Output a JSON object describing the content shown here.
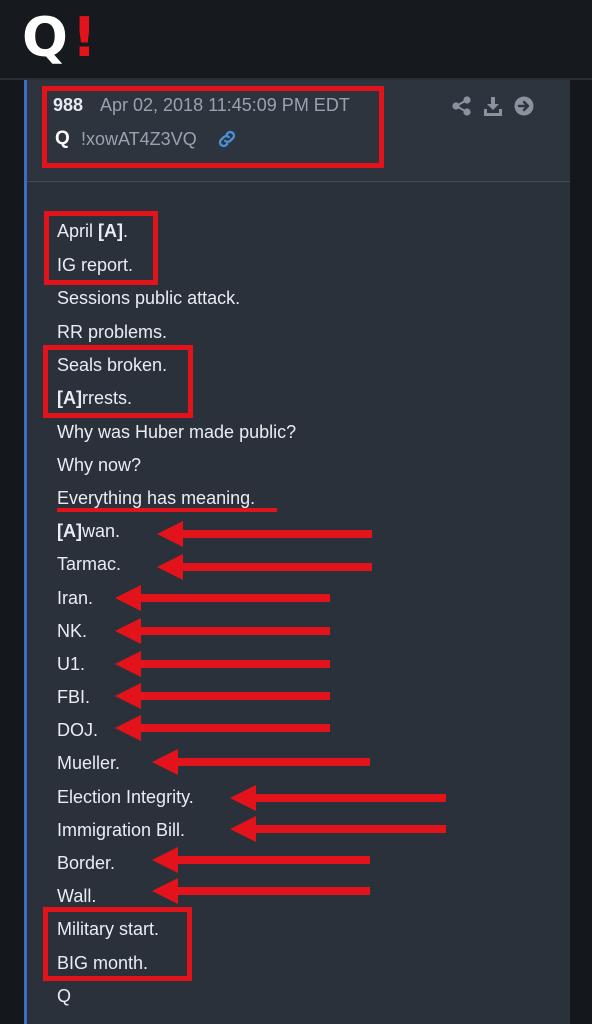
{
  "logo": {
    "letter": "Q",
    "mark": "!"
  },
  "post": {
    "number": "988",
    "date": "Apr 02, 2018 11:45:09 PM EDT",
    "author": "Q",
    "tripcode": "!xowAT4Z3VQ",
    "actions": [
      "share-icon",
      "download-icon",
      "arrow-right-circle-icon"
    ],
    "lines": [
      {
        "pre": "April ",
        "bold": "[A]",
        "post": "."
      },
      {
        "pre": "IG report.",
        "bold": "",
        "post": ""
      },
      {
        "pre": "Sessions public attack.",
        "bold": "",
        "post": ""
      },
      {
        "pre": "RR problems.",
        "bold": "",
        "post": ""
      },
      {
        "pre": "Seals broken.",
        "bold": "",
        "post": ""
      },
      {
        "pre": "",
        "bold": "[A]",
        "post": "rrests."
      },
      {
        "pre": "Why was Huber made public?",
        "bold": "",
        "post": ""
      },
      {
        "pre": "Why now?",
        "bold": "",
        "post": ""
      },
      {
        "pre": "Everything has meaning.",
        "bold": "",
        "post": ""
      },
      {
        "pre": "",
        "bold": "[A]",
        "post": "wan."
      },
      {
        "pre": "Tarmac.",
        "bold": "",
        "post": ""
      },
      {
        "pre": "Iran.",
        "bold": "",
        "post": ""
      },
      {
        "pre": "NK.",
        "bold": "",
        "post": ""
      },
      {
        "pre": "U1.",
        "bold": "",
        "post": ""
      },
      {
        "pre": "FBI.",
        "bold": "",
        "post": ""
      },
      {
        "pre": "DOJ.",
        "bold": "",
        "post": ""
      },
      {
        "pre": "Mueller.",
        "bold": "",
        "post": ""
      },
      {
        "pre": "Election Integrity.",
        "bold": "",
        "post": ""
      },
      {
        "pre": "Immigration Bill.",
        "bold": "",
        "post": ""
      },
      {
        "pre": "Border.",
        "bold": "",
        "post": ""
      },
      {
        "pre": "Wall.",
        "bold": "",
        "post": ""
      },
      {
        "pre": "Military start.",
        "bold": "",
        "post": ""
      },
      {
        "pre": "BIG month.",
        "bold": "",
        "post": ""
      },
      {
        "pre": "Q",
        "bold": "",
        "post": ""
      }
    ]
  },
  "colors": {
    "background": "#14171c",
    "post_body": "#2b313a",
    "accent_bar": "#3a6ec7",
    "annotation": "#e3131b",
    "text": "#e9edf2",
    "muted": "#9aa2ae",
    "link": "#4a90d9"
  }
}
